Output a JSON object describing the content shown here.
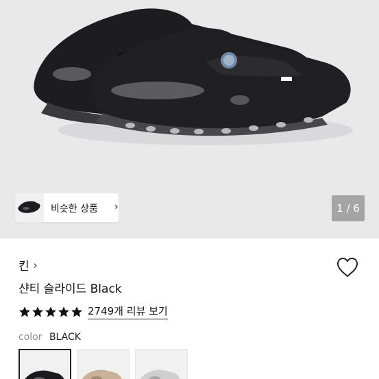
{
  "gallery": {
    "similar_button_label": "비슷한 상품",
    "similar_button_chevron": "›",
    "pager_current": "1",
    "pager_total": "6",
    "pager_text": "1 / 6"
  },
  "product": {
    "brand": "킨",
    "brand_chevron": "›",
    "name": "샨티 슬라이드 Black",
    "rating": 5,
    "rating_max": 5,
    "review_link": "2749개 리뷰 보기",
    "color_label": "color",
    "color_value": "BLACK",
    "colors": [
      "#1a1a1c",
      "#c8b196",
      "#cfcfcf"
    ],
    "selected_color_index": 0
  },
  "icons": {
    "favorite": "heart-outline-icon",
    "star": "star-filled-icon",
    "chevron": "chevron-right-icon"
  }
}
